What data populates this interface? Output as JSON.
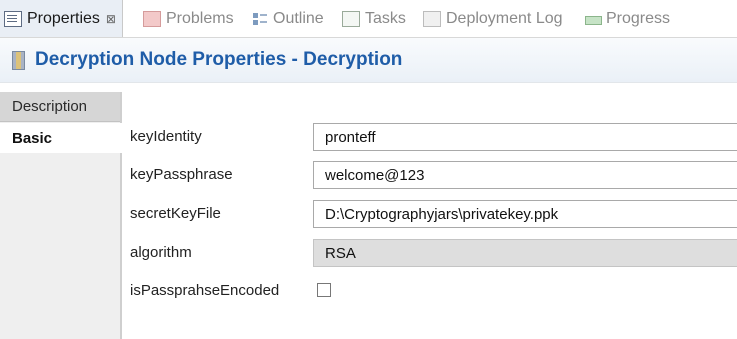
{
  "tabs": [
    {
      "label": "Properties",
      "icon": "properties-icon",
      "active": true,
      "close": "⊠"
    },
    {
      "label": "Problems",
      "icon": "problems-icon"
    },
    {
      "label": "Outline",
      "icon": "outline-icon"
    },
    {
      "label": "Tasks",
      "icon": "tasks-icon"
    },
    {
      "label": "Deployment Log",
      "icon": "deployment-log-icon"
    },
    {
      "label": "Progress",
      "icon": "progress-icon"
    }
  ],
  "title": "Decryption Node Properties - Decryption",
  "sections": {
    "description": "Description",
    "basic": "Basic"
  },
  "properties": {
    "keyIdentity": {
      "label": "keyIdentity",
      "value": "pronteff"
    },
    "keyPassphrase": {
      "label": "keyPassphrase",
      "value": "welcome@123"
    },
    "secretKeyFile": {
      "label": "secretKeyFile",
      "value": "D:\\Cryptographyjars\\privatekey.ppk"
    },
    "algorithm": {
      "label": "algorithm",
      "value": "RSA"
    },
    "isPassprahseEncoded": {
      "label": "isPassprahseEncoded",
      "checked": false
    }
  }
}
